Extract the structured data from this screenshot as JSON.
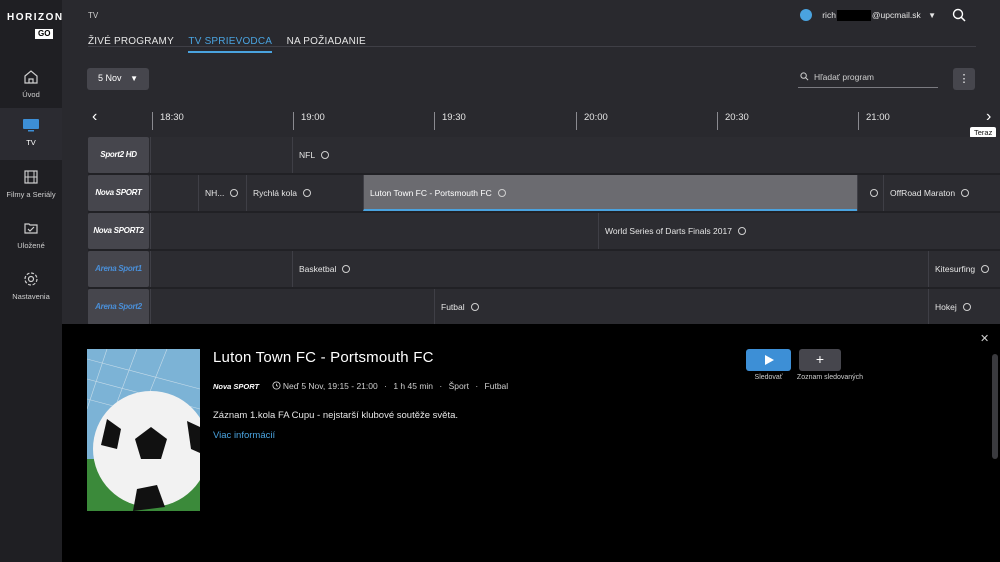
{
  "logo": {
    "main": "HORIZON",
    "sub": "GO"
  },
  "sidebar": {
    "items": [
      {
        "label": "Úvod",
        "icon": "home-icon"
      },
      {
        "label": "TV",
        "icon": "tv-icon",
        "active": true
      },
      {
        "label": "Filmy a Seriály",
        "icon": "film-icon"
      },
      {
        "label": "Uložené",
        "icon": "saved-icon"
      },
      {
        "label": "Nastavenia",
        "icon": "gear-icon"
      }
    ]
  },
  "header": {
    "title": "TV",
    "tabs": [
      {
        "label": "ŽIVÉ PROGRAMY"
      },
      {
        "label": "TV SPRIEVODCA",
        "active": true
      },
      {
        "label": "NA POŽIADANIE"
      }
    ],
    "user": {
      "name_prefix": "rich",
      "name_suffix": "@upcmail.sk"
    }
  },
  "toolbar": {
    "date": "5 Nov",
    "search_placeholder": "Hľadať program"
  },
  "timeline": {
    "ticks": [
      "18:30",
      "19:00",
      "19:30",
      "20:00",
      "20:30",
      "21:00"
    ],
    "now_label": "Teraz"
  },
  "channels": [
    {
      "logo": "Sport2 HD",
      "programs": [
        "",
        "NFL"
      ]
    },
    {
      "logo": "Nova SPORT",
      "programs": [
        "",
        "NH...",
        "Rychlá kola",
        "Luton Town FC - Portsmouth FC",
        "",
        "OffRoad Maraton"
      ]
    },
    {
      "logo": "Nova SPORT2",
      "programs": [
        "",
        "World Series of Darts Finals 2017"
      ]
    },
    {
      "logo": "Arena Sport1",
      "programs": [
        "",
        "Basketbal",
        "Kitesurfing"
      ]
    },
    {
      "logo": "Arena Sport2",
      "programs": [
        "",
        "Futbal",
        "Hokej"
      ]
    }
  ],
  "detail": {
    "title": "Luton Town FC - Portsmouth FC",
    "channel_logo": "Nova SPORT",
    "datetime": "Neď 5 Nov, 19:15 - 21:00",
    "duration": "1 h 45 min",
    "genre": "Šport",
    "subgenre": "Futbal",
    "description": "Záznam 1.kola FA Cupu - nejstarší klubové soutěže světa.",
    "more_link": "Viac informácií",
    "play_label": "Sledovať",
    "watchlist_label": "Zoznam sledovaných"
  },
  "colors": {
    "accent": "#4aa3df",
    "background": "#29292e",
    "sidebar": "#1f1f23",
    "detail_bg": "#000000"
  }
}
